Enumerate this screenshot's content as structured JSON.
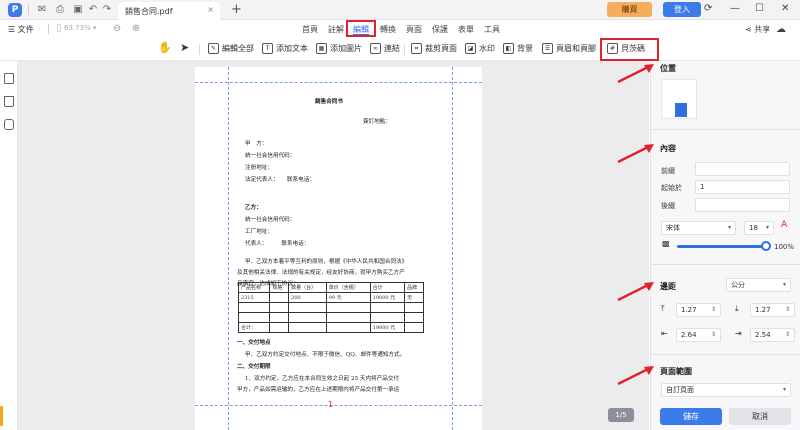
{
  "titlebar": {
    "tab_title": "銷售合同.pdf",
    "tab_close": "×",
    "new_tab": "+",
    "buy_label": "購買",
    "login_label": "登入"
  },
  "menubar": {
    "file_label": "文件",
    "zoom_value": "63.73%",
    "tabs": [
      "首頁",
      "註解",
      "編輯",
      "轉換",
      "頁面",
      "保護",
      "表單",
      "工具"
    ],
    "active_tab": "編輯",
    "share_label": "共享"
  },
  "toolbar": {
    "edit_all": "編輯全部",
    "add_text": "添加文本",
    "add_image": "添加圖片",
    "link": "連結",
    "crop_page": "裁剪頁面",
    "watermark": "水印",
    "background": "背景",
    "header_footer": "頁眉和頁腳",
    "bates": "貝茨碼"
  },
  "document": {
    "title": "銷售合同书",
    "sign_place": "簽訂地點：",
    "party_a": "甲　方：",
    "credit_code_a": "统一社会信用代码：",
    "address_a": "注册地址：",
    "rep_a": "法定代表人：　　联系电话：",
    "party_b": "乙方：",
    "credit_code_b": "统一社会信用代码：",
    "factory_b": "工厂地址：",
    "rep_b": "代表人：　　　联系电话：",
    "intro_1": "甲、乙双方本着平等互利的原则，根据《中华人民共和国合同法》",
    "intro_2": "及其他相关法律、法规的有关规定，经友好协商，就甲方购买乙方产",
    "intro_3": "品事宜，达成如下协议：",
    "table": {
      "headers": [
        "产品名称",
        "规格",
        "数量（台）",
        "单价（含税）",
        "合计",
        "品牌"
      ],
      "rows": [
        [
          "2315",
          "",
          "200",
          "99 元",
          "19800 元",
          "无"
        ],
        [
          "",
          "",
          "",
          "",
          "",
          ""
        ],
        [
          "",
          "",
          "",
          "",
          "",
          ""
        ]
      ],
      "total_label": "合计：",
      "total_value": "19800 元"
    },
    "section_1": "一、交付地点",
    "section_1_text": "甲、乙双方约定交付地点、不限于微信、QQ、邮件等通知方式。",
    "section_2": "二、交付期限",
    "section_2_text_1": "1、双方约定，乙方应在本合同生效之日起  25  天内将产品交付",
    "section_2_text_2": "甲方，产品如需运输的，乙方应在上述期限内将产品交付第一承运",
    "bates_mark": "1",
    "page_counter": "1/5"
  },
  "panel": {
    "position_title": "位置",
    "content_title": "內容",
    "prefix_label": "前綴",
    "start_label": "起始於",
    "start_value": "1",
    "suffix_label": "後綴",
    "font_name": "宋体",
    "font_size": "18",
    "opacity_value": "100%",
    "opacity_level": 1.0,
    "margin_title": "邊距",
    "unit": "公分",
    "margin_top": "1.27",
    "margin_bottom": "1.27",
    "margin_left": "2.64",
    "margin_right": "2.54",
    "range_title": "頁面範圍",
    "range_value": "自訂頁面",
    "save_label": "儲存",
    "cancel_label": "取消"
  },
  "colors": {
    "accent": "#2f6fe0",
    "annotation_red": "#e0242c",
    "buy_orange": "#f6ad5c"
  }
}
